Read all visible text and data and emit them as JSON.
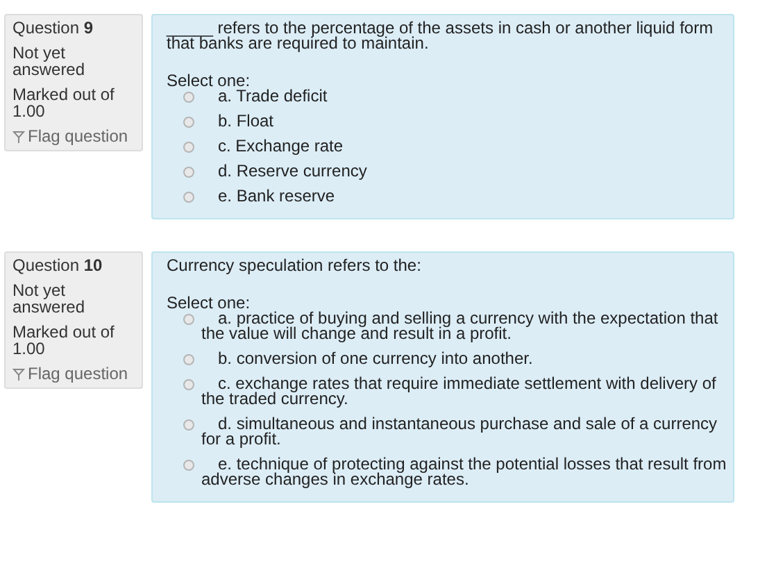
{
  "questions": [
    {
      "number": "Question **9**",
      "status": "Not yet answered",
      "marks": "Marked out of 1.00",
      "flag": "Flag question",
      "flagged": false,
      "text": "_____ refers to the percentage of the assets in cash or another liquid form that banks are required to maintain.",
      "prompt": "Select one:",
      "options": [
        {
          "label": "a. Trade deficit",
          "selected": false
        },
        {
          "label": "b. Float",
          "selected": false
        },
        {
          "label": "c. Exchange rate",
          "selected": false
        },
        {
          "label": "d. Reserve currency",
          "selected": false
        },
        {
          "label": "e. Bank reserve",
          "selected": false
        }
      ]
    },
    {
      "number": "Question **10**",
      "status": "Not yet answered",
      "marks": "Marked out of 1.00",
      "flag": "Flag question",
      "flagged": false,
      "text": "Currency speculation refers to the:",
      "prompt": "Select one:",
      "options": [
        {
          "label": "a. practice of buying and selling a currency with the expectation that the value will change and result in a profit.",
          "selected": false
        },
        {
          "label": "b. conversion of one currency into another.",
          "selected": false
        },
        {
          "label": "c. exchange rates that require immediate settlement with delivery of the traded currency.",
          "selected": false
        },
        {
          "label": "d. simultaneous and instantaneous purchase and sale of a currency for a profit.",
          "selected": false
        },
        {
          "label": "e. technique of protecting against the potential losses that result from adverse changes in exchange rates.",
          "selected": false
        }
      ]
    }
  ]
}
